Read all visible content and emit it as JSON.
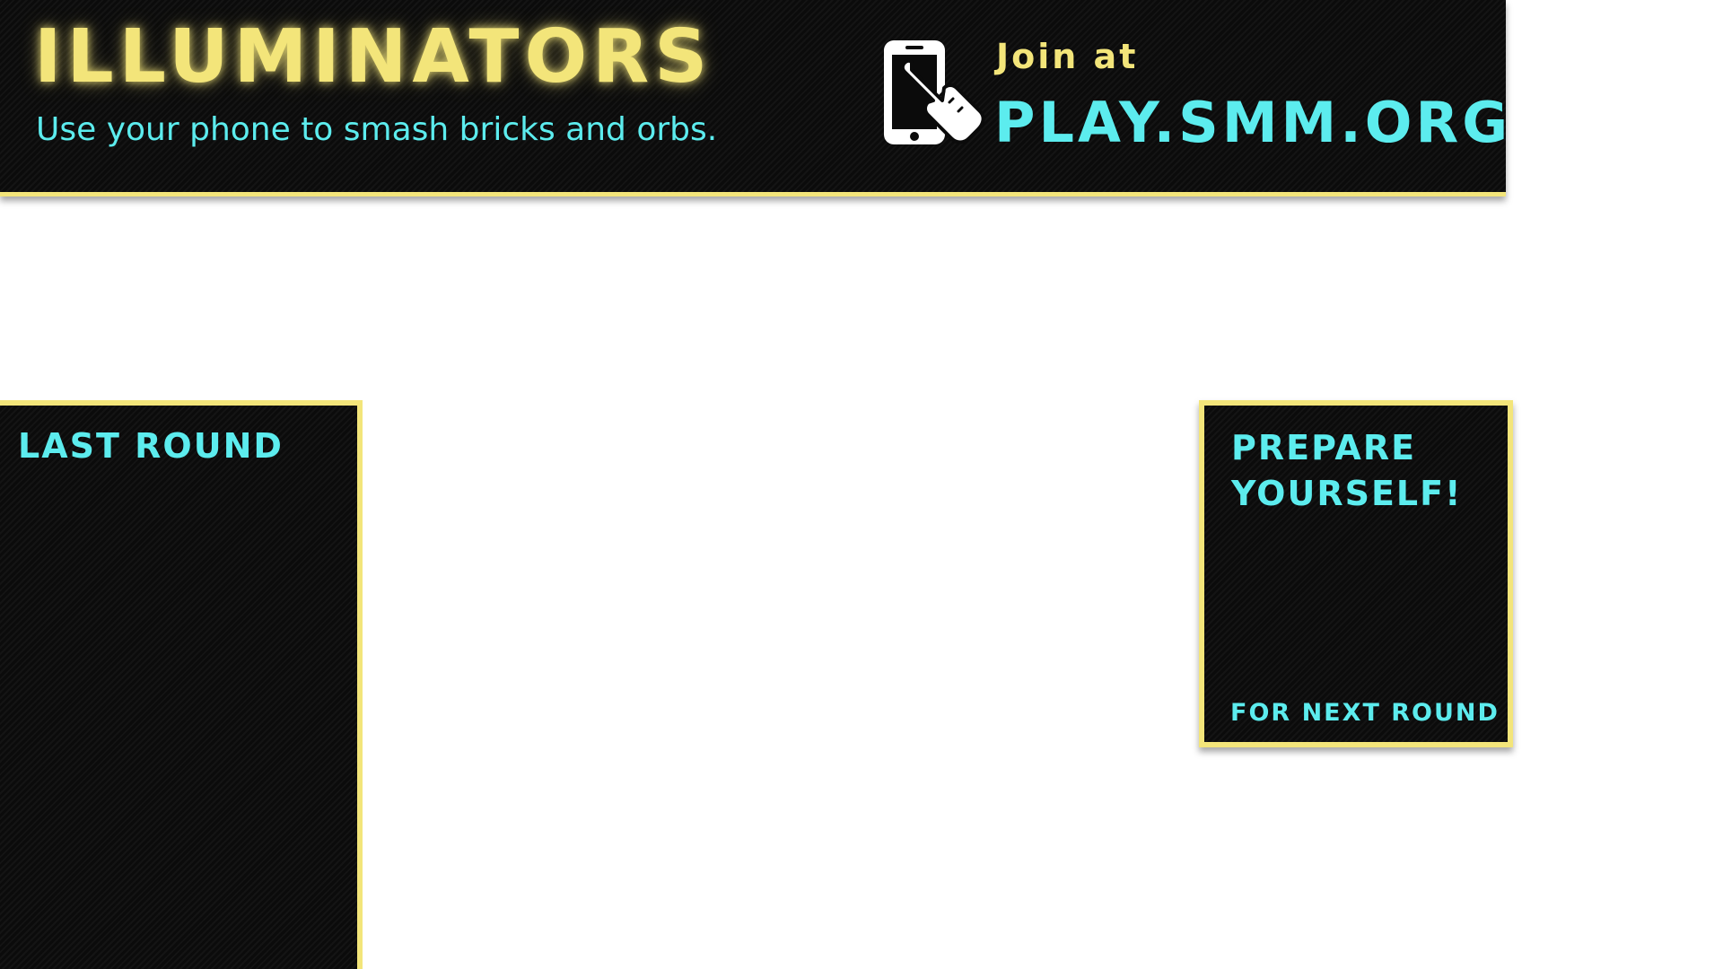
{
  "header": {
    "title": "ILLUMINATORS",
    "subtitle": "Use your phone to smash bricks and orbs.",
    "join_label": "Join at",
    "join_url": "PLAY.SMM.ORG",
    "icon": "phone-tap-icon"
  },
  "panels": {
    "last_round": {
      "title": "LAST ROUND"
    },
    "next_round": {
      "title": "PREPARE YOURSELF!",
      "footer": "FOR NEXT ROUND"
    }
  },
  "colors": {
    "accent_yellow": "#f3e57a",
    "accent_cyan": "#5cecee",
    "panel_background": "#0b0b0b",
    "page_background": "#ffffff"
  }
}
